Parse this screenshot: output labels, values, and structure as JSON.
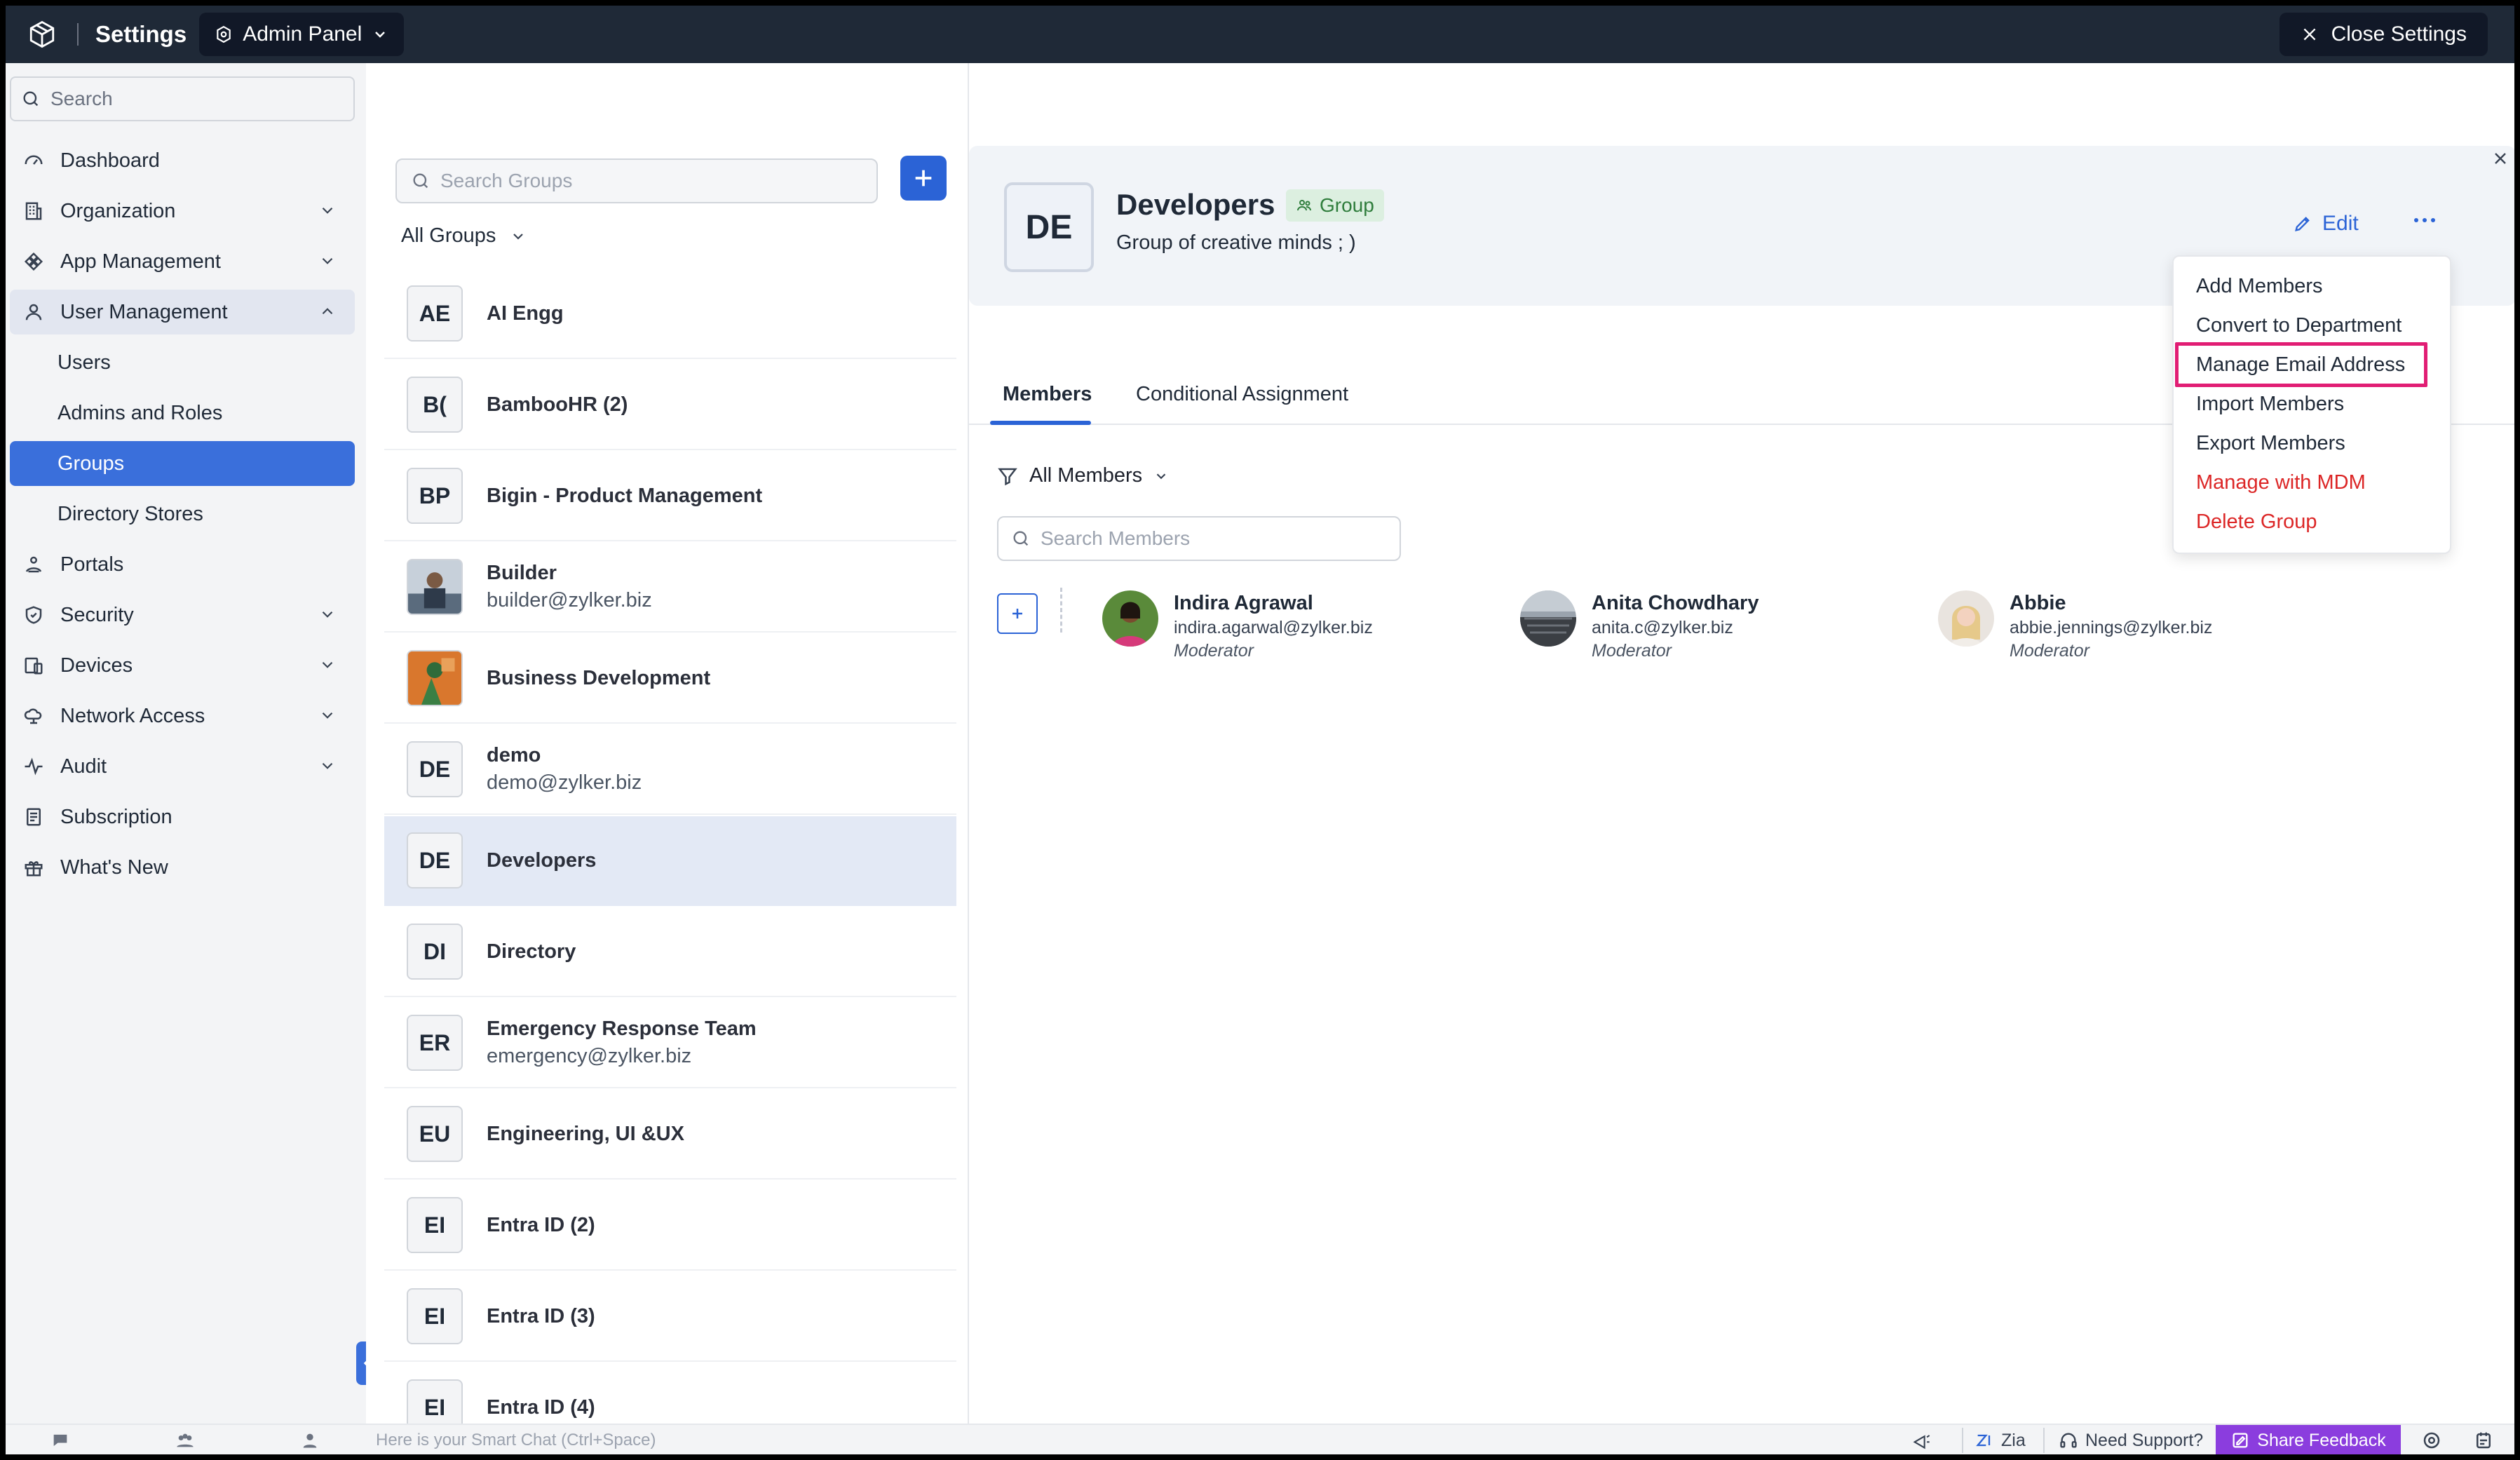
{
  "topbar": {
    "title": "Settings",
    "panel_label": "Admin Panel",
    "close_label": "Close Settings"
  },
  "sidebar": {
    "search_placeholder": "Search",
    "items": [
      {
        "label": "Dashboard",
        "icon": "gauge-icon"
      },
      {
        "label": "Organization",
        "icon": "building-icon"
      },
      {
        "label": "App Management",
        "icon": "apps-icon"
      },
      {
        "label": "User Management",
        "icon": "user-icon"
      },
      {
        "label": "Users"
      },
      {
        "label": "Admins and Roles"
      },
      {
        "label": "Groups"
      },
      {
        "label": "Directory Stores"
      },
      {
        "label": "Portals",
        "icon": "portal-icon"
      },
      {
        "label": "Security",
        "icon": "shield-icon"
      },
      {
        "label": "Devices",
        "icon": "devices-icon"
      },
      {
        "label": "Network Access",
        "icon": "cloud-icon"
      },
      {
        "label": "Audit",
        "icon": "pulse-icon"
      },
      {
        "label": "Subscription",
        "icon": "receipt-icon"
      },
      {
        "label": "What's New",
        "icon": "gift-icon"
      }
    ]
  },
  "groups": {
    "search_placeholder": "Search Groups",
    "filter_label": "All Groups",
    "list": [
      {
        "initials": "AE",
        "name": "AI Engg",
        "email": ""
      },
      {
        "initials": "B(",
        "name": "BambooHR (2)",
        "email": ""
      },
      {
        "initials": "BP",
        "name": "Bigin - Product Management",
        "email": ""
      },
      {
        "initials": "",
        "name": "Builder",
        "email": "builder@zylker.biz"
      },
      {
        "initials": "",
        "name": "Business Development",
        "email": ""
      },
      {
        "initials": "DE",
        "name": "demo",
        "email": "demo@zylker.biz"
      },
      {
        "initials": "DE",
        "name": "Developers",
        "email": ""
      },
      {
        "initials": "DI",
        "name": "Directory",
        "email": ""
      },
      {
        "initials": "ER",
        "name": "Emergency Response Team",
        "email": "emergency@zylker.biz"
      },
      {
        "initials": "EU",
        "name": "Engineering, UI &UX",
        "email": ""
      },
      {
        "initials": "EI",
        "name": "Entra ID (2)",
        "email": ""
      },
      {
        "initials": "EI",
        "name": "Entra ID (3)",
        "email": ""
      },
      {
        "initials": "EI",
        "name": "Entra ID (4)",
        "email": ""
      }
    ]
  },
  "detail": {
    "initials": "DE",
    "title": "Developers",
    "badge": "Group",
    "description": "Group of creative minds ; )",
    "edit_label": "Edit",
    "tabs": [
      "Members",
      "Conditional Assignment"
    ],
    "filter_label": "All Members",
    "search_placeholder": "Search Members",
    "members": [
      {
        "name": "Indira Agrawal",
        "email": "indira.agarwal@zylker.biz",
        "role": "Moderator"
      },
      {
        "name": "Anita Chowdhary",
        "email": "anita.c@zylker.biz",
        "role": "Moderator"
      },
      {
        "name": "Abbie",
        "email": "abbie.jennings@zylker.biz",
        "role": "Moderator"
      }
    ]
  },
  "menu": {
    "items": [
      {
        "label": "Add Members"
      },
      {
        "label": "Convert to Department"
      },
      {
        "label": "Manage Email Address"
      },
      {
        "label": "Import Members"
      },
      {
        "label": "Export Members"
      },
      {
        "label": "Manage with MDM"
      },
      {
        "label": "Delete Group"
      }
    ]
  },
  "bottombar": {
    "chat_placeholder": "Here is your Smart Chat (Ctrl+Space)",
    "zia_label": "Zia",
    "support_label": "Need Support?",
    "feedback_label": "Share Feedback"
  },
  "colors": {
    "accent": "#2b63d6",
    "active_nav": "#3a6fdb",
    "danger": "#dc2626",
    "highlight": "#e11d74",
    "topbar": "#1f2937",
    "feedback": "#8b3dde"
  }
}
